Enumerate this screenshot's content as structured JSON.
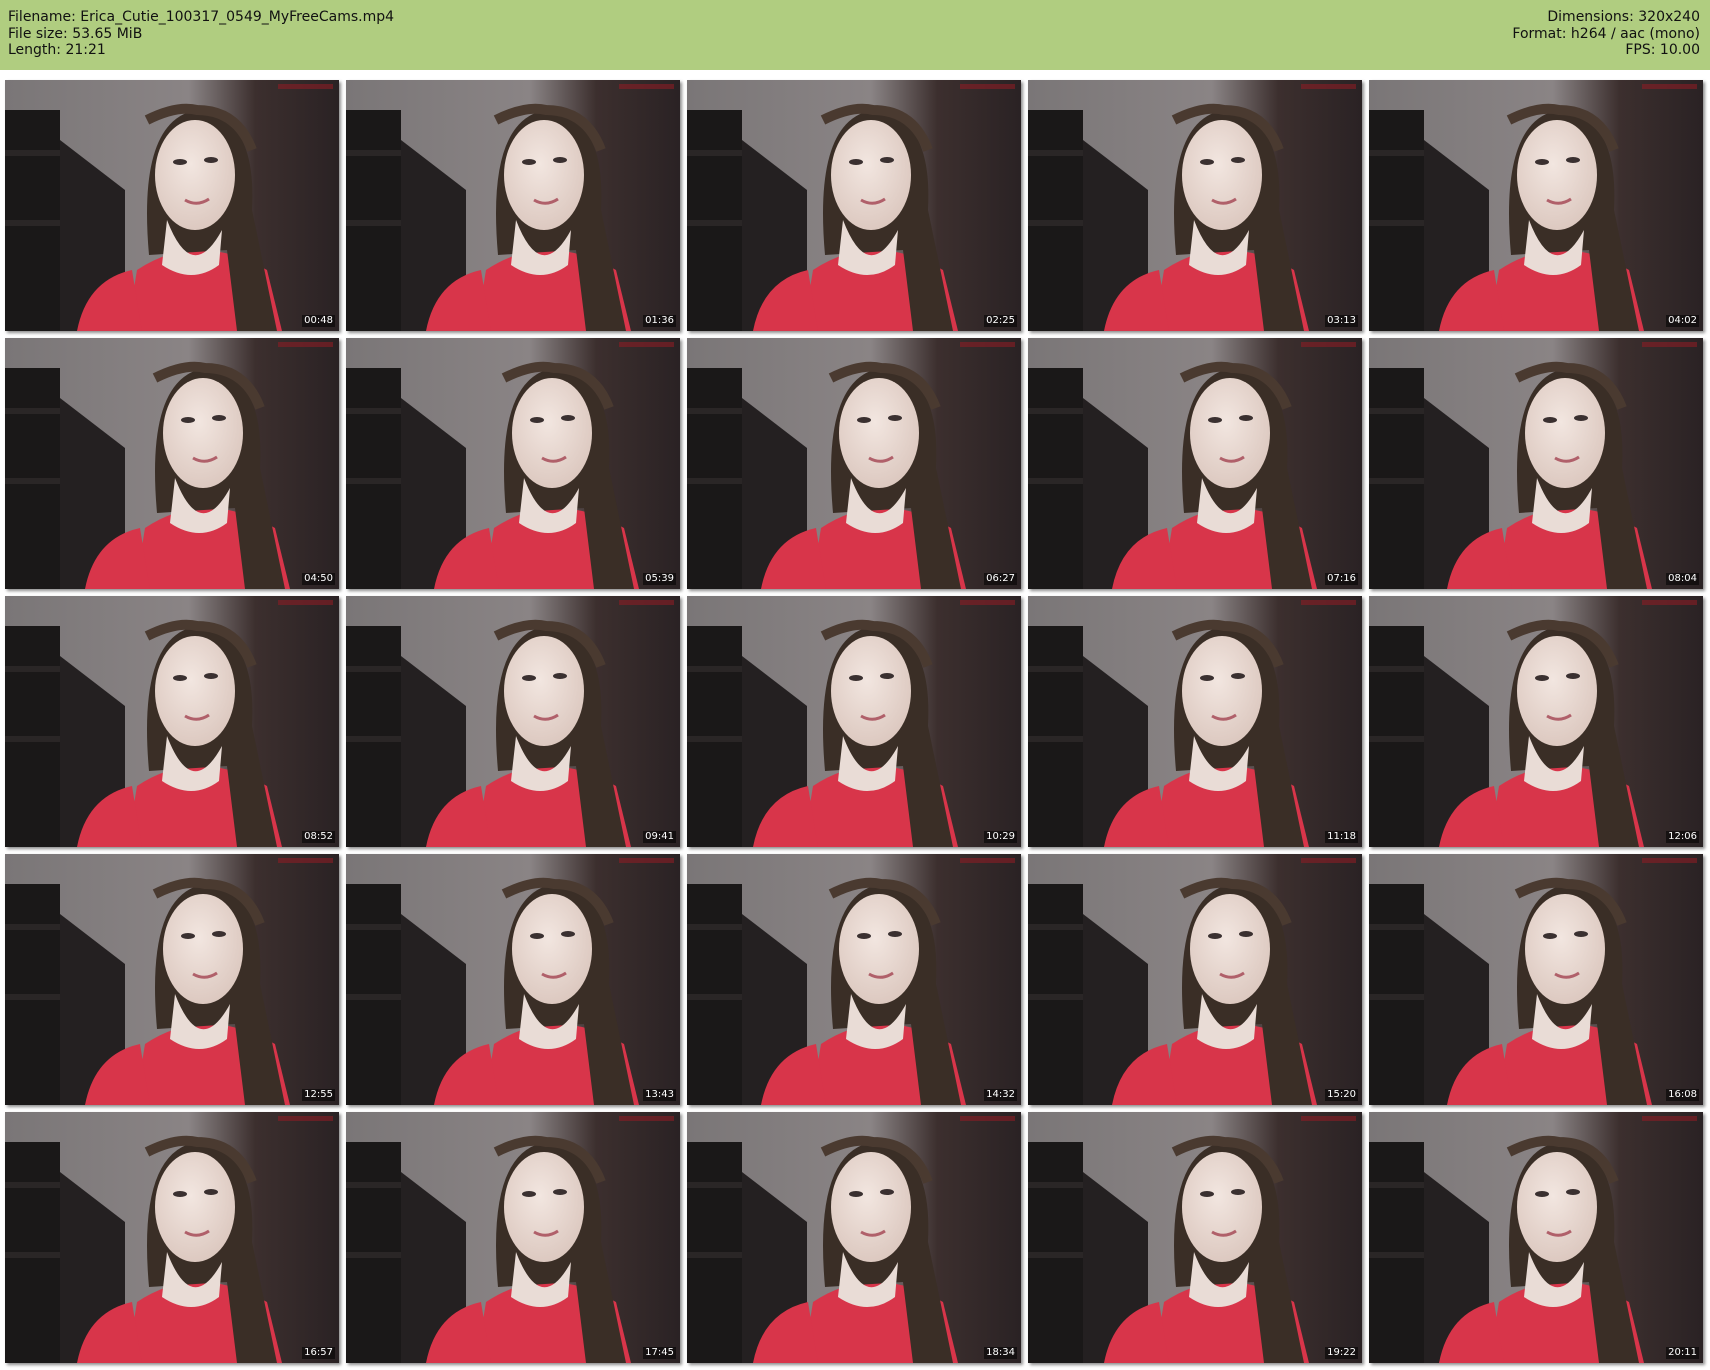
{
  "header": {
    "filename_line": "Filename: Erica_Cutie_100317_0549_MyFreeCams.mp4",
    "filesize_line": "File size: 53.65 MiB",
    "length_line": "Length: 21:21",
    "dimensions_line": "Dimensions: 320x240",
    "format_line": "Format: h264 / aac (mono)",
    "fps_line": "FPS: 10.00",
    "background_color": "#b0cd80"
  },
  "thumbnails": [
    {
      "timestamp": "00:48"
    },
    {
      "timestamp": "01:36"
    },
    {
      "timestamp": "02:25"
    },
    {
      "timestamp": "03:13"
    },
    {
      "timestamp": "04:02"
    },
    {
      "timestamp": "04:50"
    },
    {
      "timestamp": "05:39"
    },
    {
      "timestamp": "06:27"
    },
    {
      "timestamp": "07:16"
    },
    {
      "timestamp": "08:04"
    },
    {
      "timestamp": "08:52"
    },
    {
      "timestamp": "09:41"
    },
    {
      "timestamp": "10:29"
    },
    {
      "timestamp": "11:18"
    },
    {
      "timestamp": "12:06"
    },
    {
      "timestamp": "12:55"
    },
    {
      "timestamp": "13:43"
    },
    {
      "timestamp": "14:32"
    },
    {
      "timestamp": "15:20"
    },
    {
      "timestamp": "16:08"
    },
    {
      "timestamp": "16:57"
    },
    {
      "timestamp": "17:45"
    },
    {
      "timestamp": "18:34"
    },
    {
      "timestamp": "19:22"
    },
    {
      "timestamp": "20:11"
    }
  ],
  "frame_colors": {
    "wall": "#6a6566",
    "furniture": "#1a1818",
    "hair": "#3a2e26",
    "skin": "#d9c4bb",
    "shirt": "#d8354a"
  }
}
